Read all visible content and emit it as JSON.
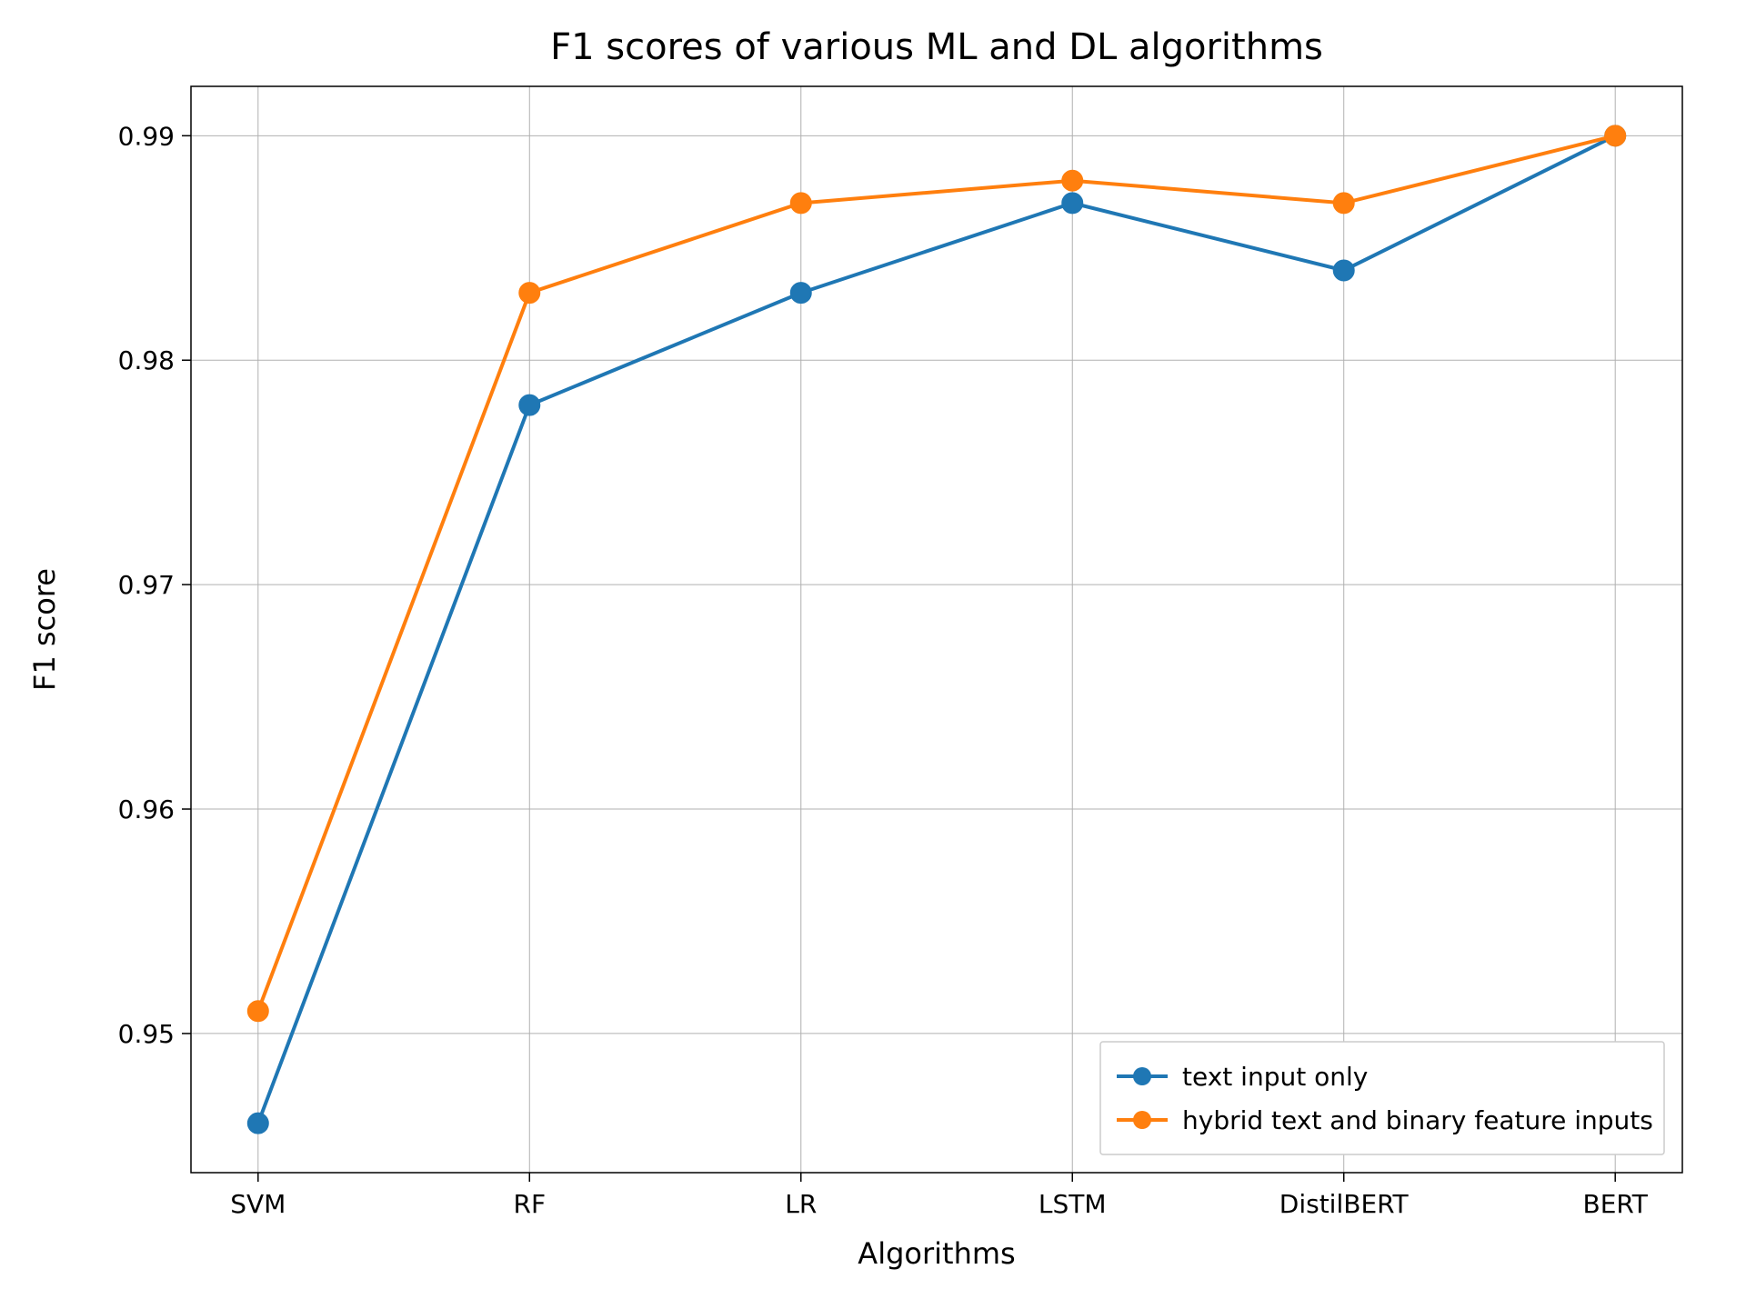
{
  "chart_data": {
    "type": "line",
    "title": "F1 scores of various ML and DL algorithms",
    "xlabel": "Algorithms",
    "ylabel": "F1 score",
    "categories": [
      "SVM",
      "RF",
      "LR",
      "LSTM",
      "DistilBERT",
      "BERT"
    ],
    "series": [
      {
        "name": "text input only",
        "color": "#1f77b4",
        "values": [
          0.946,
          0.978,
          0.983,
          0.987,
          0.984,
          0.99
        ]
      },
      {
        "name": "hybrid text and binary feature inputs",
        "color": "#ff7f0e",
        "values": [
          0.951,
          0.983,
          0.987,
          0.988,
          0.987,
          0.99
        ]
      }
    ],
    "yticks": [
      0.95,
      0.96,
      0.97,
      0.98,
      0.99
    ],
    "ylim": [
      0.9438,
      0.9922
    ],
    "grid": true,
    "legend_position": "lower right"
  }
}
